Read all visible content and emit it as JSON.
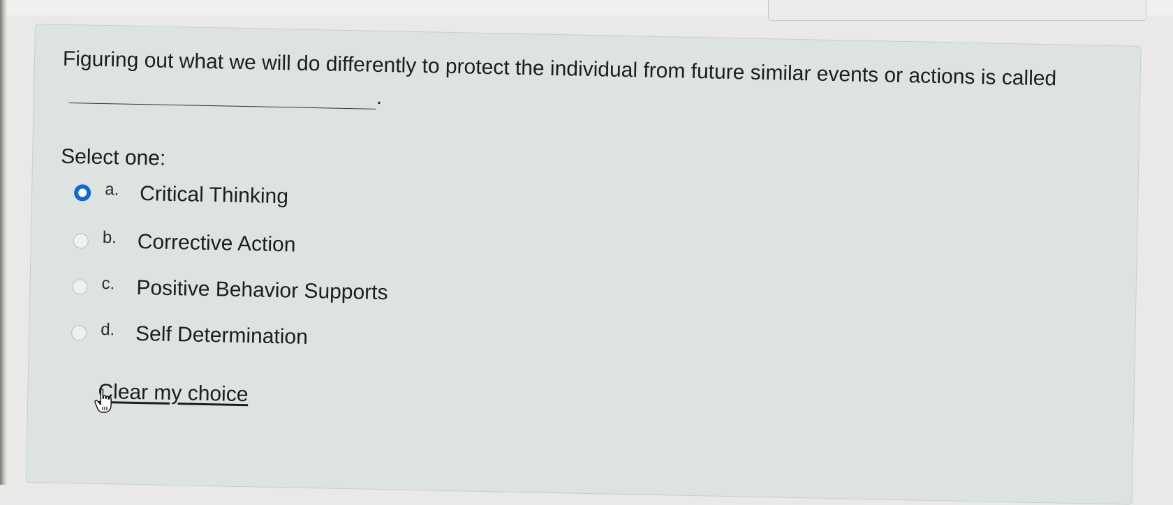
{
  "question": {
    "text": "Figuring out what we will do differently to protect the individual from future similar events or actions is called",
    "end_punct": "."
  },
  "prompt": "Select one:",
  "options": [
    {
      "letter": "a.",
      "label": "Critical Thinking",
      "selected": true
    },
    {
      "letter": "b.",
      "label": "Corrective Action",
      "selected": false
    },
    {
      "letter": "c.",
      "label": "Positive Behavior Supports",
      "selected": false
    },
    {
      "letter": "d.",
      "label": "Self Determination",
      "selected": false
    }
  ],
  "clear_choice": "Clear my choice",
  "colors": {
    "radio_selected": "#0f68d8",
    "card_background": "#dde3e1"
  },
  "icons": {
    "cursor": "hand-pointer-icon"
  }
}
